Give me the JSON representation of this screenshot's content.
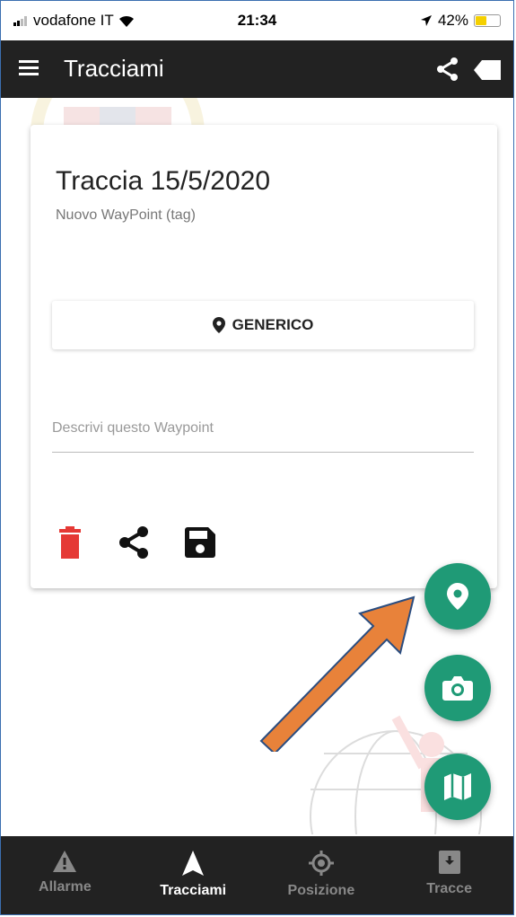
{
  "status_bar": {
    "carrier": "vodafone IT",
    "time": "21:34",
    "battery_percent": "42%",
    "battery_level": 0.42,
    "battery_color": "#f5d000"
  },
  "app_bar": {
    "title": "Tracciami",
    "menu_icon": "menu-icon",
    "share_icon": "share-icon",
    "tag_icon": "tag-icon"
  },
  "card": {
    "title": "Traccia 15/5/2020",
    "subtitle": "Nuovo WayPoint (tag)",
    "category_button": "GENERICO",
    "description_placeholder": "Descrivi questo Waypoint",
    "actions": [
      "delete-icon",
      "share-icon",
      "save-icon"
    ],
    "delete_color": "#e53935"
  },
  "fabs": [
    "map-marker-icon",
    "camera-icon",
    "map-icon"
  ],
  "accent_color": "#1f9a76",
  "annotation_arrow_color": "#e8823a",
  "bottom_nav": {
    "items": [
      {
        "label": "Allarme",
        "icon": "warning-icon",
        "active": false
      },
      {
        "label": "Tracciami",
        "icon": "navigation-icon",
        "active": true
      },
      {
        "label": "Posizione",
        "icon": "location-target-icon",
        "active": false
      },
      {
        "label": "Tracce",
        "icon": "archive-icon",
        "active": false
      }
    ]
  }
}
